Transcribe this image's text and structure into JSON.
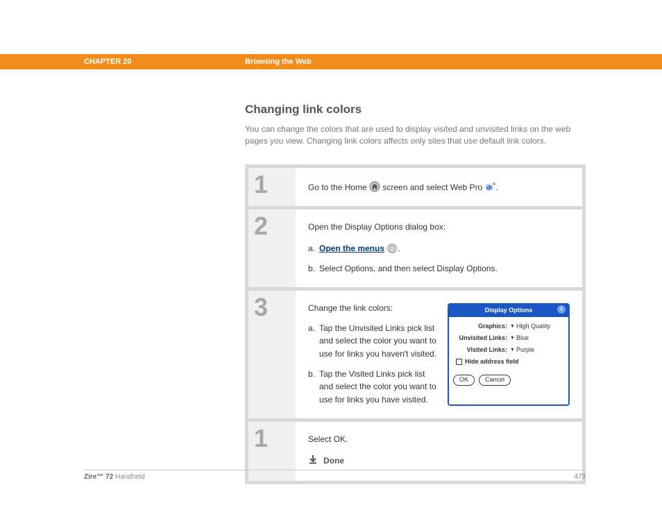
{
  "header": {
    "chapter": "CHAPTER 20",
    "section": "Browsing the Web"
  },
  "title": "Changing link colors",
  "intro": "You can change the colors that are used to display visited and unvisited links on the web pages you view. Changing link colors affects only sites that use default link colors.",
  "steps": [
    {
      "num": "1",
      "lead_a": "Go to the Home ",
      "lead_b": " screen and select Web Pro ",
      "lead_c": "."
    },
    {
      "num": "2",
      "lead": "Open the Display Options dialog box:",
      "sub_a_letter": "a.",
      "sub_a_link": "Open the menus",
      "sub_a_tail": ".",
      "sub_b_letter": "b.",
      "sub_b": "Select Options, and then select Display Options."
    },
    {
      "num": "3",
      "lead": "Change the link colors:",
      "sub_a_letter": "a.",
      "sub_a": "Tap the Unvisited Links pick list and select the color you want to use for links you haven't visited.",
      "sub_b_letter": "b.",
      "sub_b": "Tap the Visited Links pick list and select the color you want to use for links you have visited."
    },
    {
      "num": "1",
      "lead": "Select OK.",
      "done": "Done"
    }
  ],
  "dialog": {
    "title": "Display Options",
    "info": "i",
    "rows": {
      "graphics_label": "Graphics:",
      "graphics_value": "High Quality",
      "unvisited_label": "Unvisited Links:",
      "unvisited_value": "Blue",
      "visited_label": "Visited Links:",
      "visited_value": "Purple",
      "hide_label": "Hide address field"
    },
    "ok": "OK",
    "cancel": "Cancel"
  },
  "footer": {
    "product_bold": "Zire™ 72",
    "product_rest": " Handheld",
    "page": "473"
  }
}
